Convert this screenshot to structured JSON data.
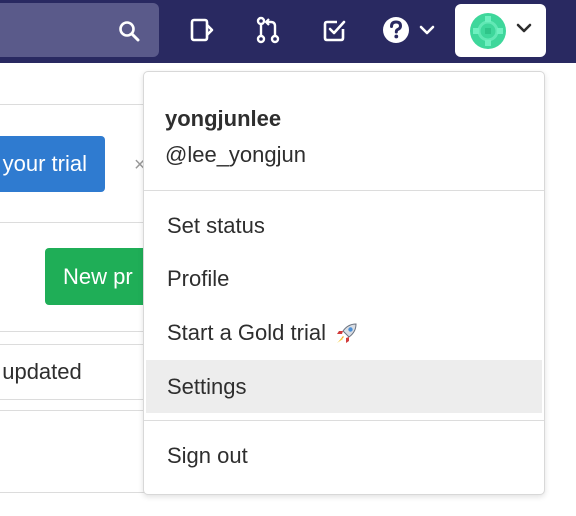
{
  "user_menu": {
    "username": "yongjunlee",
    "handle": "@lee_yongjun",
    "items": [
      {
        "label": "Set status"
      },
      {
        "label": "Profile"
      },
      {
        "label": "Start a Gold trial",
        "icon": "rocket-icon"
      },
      {
        "label": "Settings",
        "state": "hovered"
      },
      {
        "label": "Sign out"
      }
    ]
  },
  "background": {
    "trial_button": "your trial",
    "dismiss": "×",
    "new_project_button": "New pr",
    "sort_label": "t updated"
  },
  "navbar": {
    "icons": [
      "search-icon",
      "todo-list-icon",
      "merge-requests-icon",
      "issues-check-icon",
      "help-icon",
      "chevron-down-icon"
    ]
  },
  "colors": {
    "navbar": "#292961",
    "search": "#5a5a8a",
    "trial_button": "#2f7bd0",
    "new_project_button": "#1fae57",
    "hover_row": "#ededed"
  }
}
